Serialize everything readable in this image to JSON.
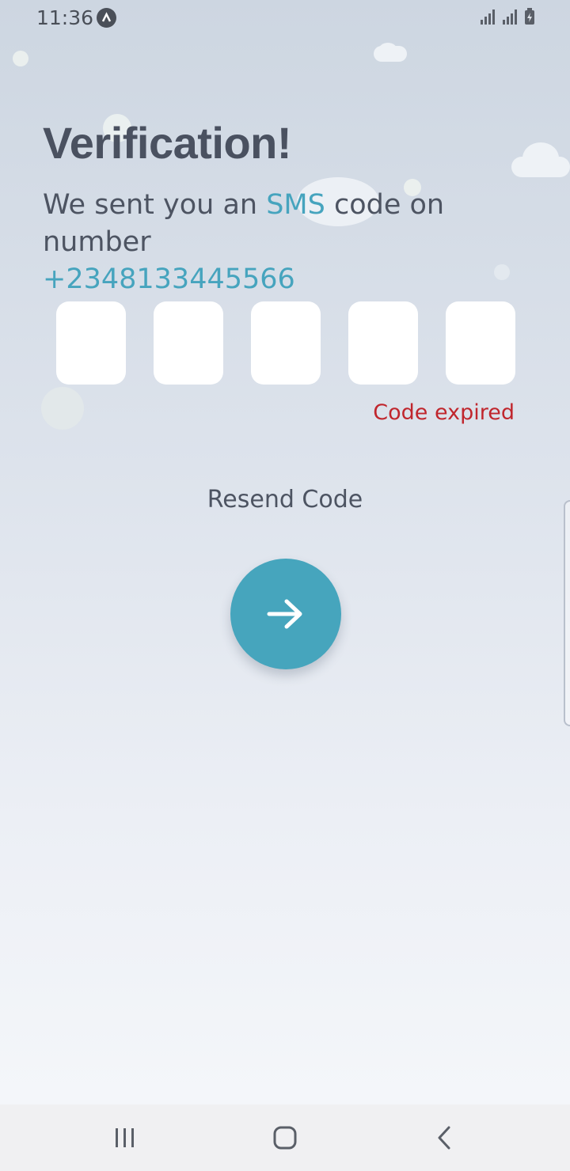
{
  "status": {
    "time": "11:36",
    "app_icon": "app-notification-icon",
    "signal_icon": "signal-icon",
    "battery_icon": "battery-charging-icon"
  },
  "content": {
    "title": "Verification!",
    "desc_prefix": "We sent you an ",
    "desc_sms": "SMS",
    "desc_suffix": " code on number",
    "phone": "+2348133445566",
    "code_boxes": [
      "",
      "",
      "",
      "",
      ""
    ],
    "error": "Code expired",
    "resend": "Resend Code",
    "next_icon": "arrow-right-icon"
  },
  "nav": {
    "recents_icon": "recents-icon",
    "home_icon": "home-icon",
    "back_icon": "back-icon"
  },
  "colors": {
    "accent": "#46a4be",
    "error": "#c0262d",
    "text": "#4a5160"
  }
}
